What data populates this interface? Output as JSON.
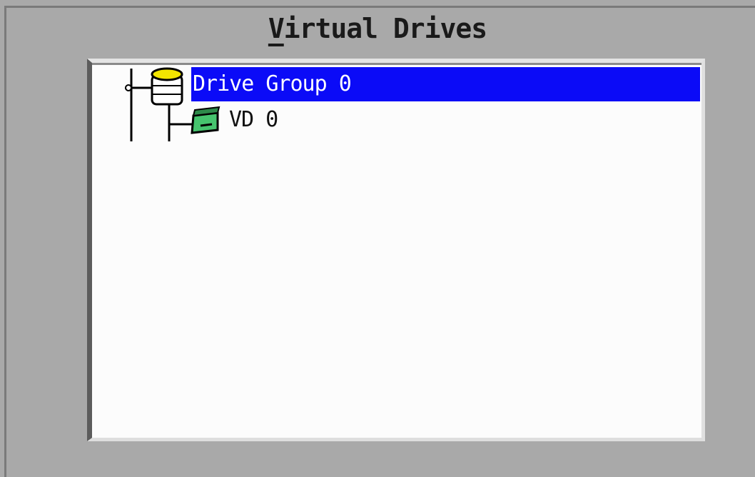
{
  "window": {
    "title_hotkey": "V",
    "title_rest": "irtual Drives"
  },
  "tree": {
    "nodes": [
      {
        "label": "Drive Group 0",
        "icon": "drive-group-icon",
        "selected": true,
        "level": 0
      },
      {
        "label": "VD 0",
        "icon": "virtual-drive-icon",
        "selected": false,
        "level": 1
      }
    ]
  },
  "colors": {
    "background": "#a9a9a9",
    "panel": "#fcfcfc",
    "selection": "#0b0bf7",
    "selection_text": "#ffffff",
    "disk_top": "#f2e500",
    "vd_icon": "#46c46e"
  }
}
